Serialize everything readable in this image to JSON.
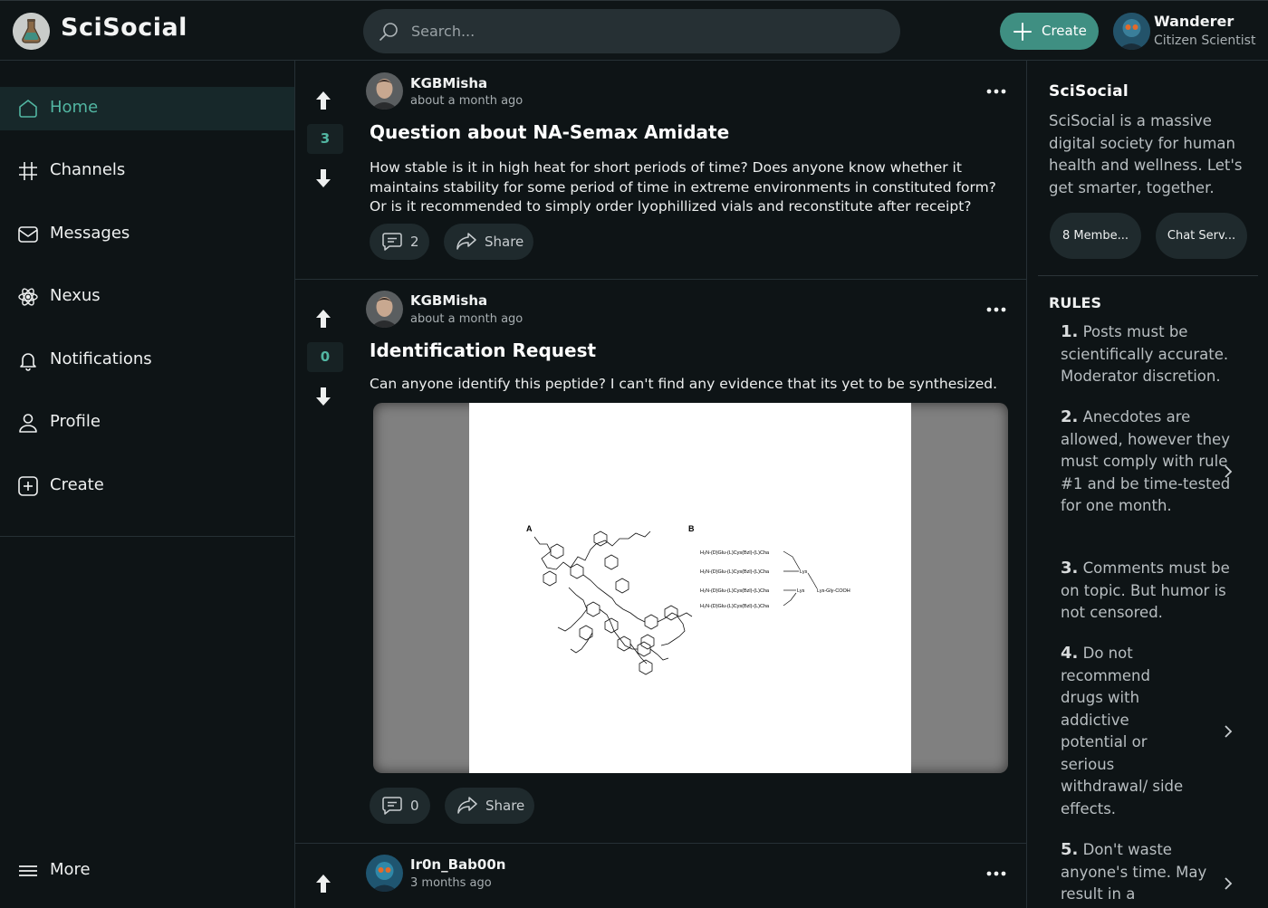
{
  "header": {
    "app_title": "SciSocial",
    "search_placeholder": "Search...",
    "create_label": "Create",
    "user": {
      "name": "Wanderer",
      "role": "Citizen Scientist"
    }
  },
  "nav": {
    "items": [
      {
        "label": "Home",
        "icon": "home-icon",
        "active": true
      },
      {
        "label": "Channels",
        "icon": "hashtag-icon"
      },
      {
        "label": "Messages",
        "icon": "envelope-icon"
      },
      {
        "label": "Nexus",
        "icon": "atom-icon"
      },
      {
        "label": "Notifications",
        "icon": "bell-icon"
      },
      {
        "label": "Profile",
        "icon": "user-icon"
      },
      {
        "label": "Create",
        "icon": "plus-square-icon"
      }
    ],
    "more_label": "More"
  },
  "posts": [
    {
      "votes": "3",
      "author": "KGBMisha",
      "time": "about a month ago",
      "title": "Question about NA-Semax Amidate",
      "body": "How stable is it in high heat for short periods of time? Does anyone know whether it maintains stability for some period of time in extreme environments in constituted form? Or is it recommended to simply order lyophillized vials and reconstitute after receipt?",
      "comments": "2",
      "share_label": "Share"
    },
    {
      "votes": "0",
      "author": "KGBMisha",
      "time": "about a month ago",
      "title": "Identification Request",
      "body": "Can anyone identify this peptide? I can't find any evidence that its yet to be synthesized.",
      "image": {
        "label_a": "A",
        "label_b": "B",
        "chains": [
          "H₂N-(D)Glu-(L)Cys(Bzl)-(L)Cha",
          "H₂N-(D)Glu-(L)Cys(Bzl)-(L)Cha",
          "H₂N-(D)Glu-(L)Cys(Bzl)-(L)Cha",
          "H₂N-(D)Glu-(L)Cys(Bzl)-(L)Cha"
        ],
        "lys_a": "Lys",
        "lys_b": "Lys",
        "terminal": "Lys-Gly-COOH"
      },
      "comments": "0",
      "share_label": "Share"
    },
    {
      "author": "Ir0n_Bab00n",
      "time": "3 months ago"
    }
  ],
  "sidebar": {
    "title": "SciSocial",
    "description": "SciSocial is a massive digital society for human health and wellness. Let's get smarter, together.",
    "chips": [
      "8 Membe...",
      "Chat Serv..."
    ],
    "rules_title": "RULES",
    "rules": [
      {
        "num": "1.",
        "text": "Posts must be scientifically accurate. Moderator discretion."
      },
      {
        "num": "2.",
        "text": "Anecdotes are allowed, however they must comply with rule #1 and be time-tested for one month."
      },
      {
        "num": "3.",
        "text": "Comments must be on topic. But humor is not censored."
      },
      {
        "num": "4.",
        "text": "Do not recommend drugs with addictive potential or serious withdrawal/ side effects."
      },
      {
        "num": "5.",
        "text": "Don't waste anyone's time. May result in a"
      }
    ]
  },
  "colors": {
    "accent": "#52b6a2",
    "create_button": "#3f8f82",
    "background": "#0e1416",
    "pill": "#1f2a2d"
  }
}
